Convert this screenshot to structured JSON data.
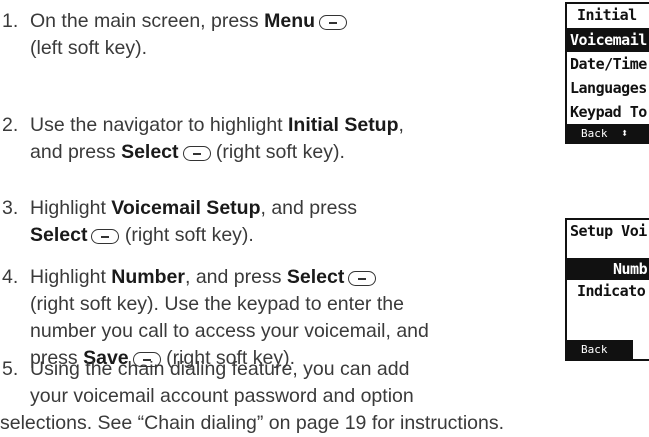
{
  "steps": [
    {
      "number": "1.",
      "lines": [
        [
          {
            "t": "On the main screen, press "
          },
          {
            "b": "Menu"
          },
          {
            "k": true
          }
        ],
        [
          {
            "t": "(left soft key)."
          }
        ]
      ]
    },
    {
      "number": "2.",
      "lines": [
        [
          {
            "t": "Use the navigator to highlight "
          },
          {
            "b": "Initial Setup"
          },
          {
            "t": ","
          }
        ],
        [
          {
            "t": "and press "
          },
          {
            "b": "Select"
          },
          {
            "k": true
          },
          {
            "t": " (right soft key)."
          }
        ]
      ]
    },
    {
      "number": "3.",
      "lines": [
        [
          {
            "t": "Highlight "
          },
          {
            "b": "Voicemail Setup"
          },
          {
            "t": ", and press"
          }
        ],
        [
          {
            "b": "Select"
          },
          {
            "k": true
          },
          {
            "t": " (right soft key)."
          }
        ]
      ]
    },
    {
      "number": "4.",
      "lines": [
        [
          {
            "t": "Highlight "
          },
          {
            "b": "Number"
          },
          {
            "t": ", and press "
          },
          {
            "b": "Select"
          },
          {
            "k": true
          }
        ],
        [
          {
            "t": "(right soft key). Use the keypad to enter the"
          }
        ],
        [
          {
            "t": "number you call to access your voicemail, and"
          }
        ],
        [
          {
            "t": "press "
          },
          {
            "b": "Save"
          },
          {
            "k": true
          },
          {
            "t": " (right soft key)."
          }
        ]
      ]
    },
    {
      "number": "5.",
      "lines": [
        [
          {
            "t": "Using the chain dialing feature, you can add"
          }
        ],
        [
          {
            "t": "your voicemail account password and option"
          }
        ],
        [
          {
            "t": "selections. See “Chain dialing” on page 19 for instructions."
          }
        ]
      ]
    }
  ],
  "screen1": {
    "title": "Initial",
    "items": [
      "Voicemail",
      "Date/Time",
      "Languages",
      "Keypad To"
    ],
    "highlighted_index": 0,
    "back_label": "Back",
    "scroll_icon": "up-down-arrows-icon"
  },
  "screen2": {
    "title": "Setup Voi",
    "highlighted": "Numb",
    "indicator": "Indicato",
    "back_label": "Back"
  },
  "colors": {
    "text": "#3a3a3a",
    "bold": "#1a1a1a",
    "lcd_dark": "#111111"
  }
}
